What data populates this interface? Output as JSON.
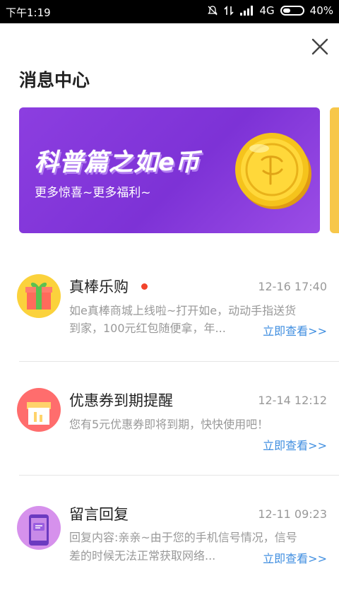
{
  "status_bar": {
    "time": "下午1:19",
    "network": "4G",
    "battery": "40%",
    "battery_level": 0.4,
    "icons": [
      "mute-icon",
      "data-icon",
      "signal-icon",
      "battery-icon"
    ]
  },
  "header": {
    "title": "消息中心",
    "close_icon": "close-icon"
  },
  "banner": {
    "title": "科普篇之如e币",
    "subtitle": "更多惊喜~更多福利~",
    "icon": "coin-icon"
  },
  "messages": [
    {
      "title": "真棒乐购",
      "unread": true,
      "time": "12-16 17:40",
      "body_line1": "如e真棒商城上线啦~打开如e，动动手指送货",
      "body_line2": "到家，100元红包随便拿，年...",
      "link": "立即查看>>",
      "icon": "gift-icon"
    },
    {
      "title": "优惠券到期提醒",
      "unread": false,
      "time": "12-14 12:12",
      "body_line1": "您有5元优惠券即将到期，快快使用吧！",
      "body_line2": "",
      "link": "立即查看>>",
      "icon": "coupon-icon"
    },
    {
      "title": "留言回复",
      "unread": false,
      "time": "12-11 09:23",
      "body_line1": "回复内容:亲亲~由于您的手机信号情况，信号",
      "body_line2": "差的时候无法正常获取网络...",
      "link": "立即查看>>",
      "icon": "chat-phone-icon"
    }
  ],
  "colors": {
    "accent_link": "#3f8ee0",
    "banner_purple": "#8c3ee0",
    "unread_dot": "#f2442c"
  }
}
